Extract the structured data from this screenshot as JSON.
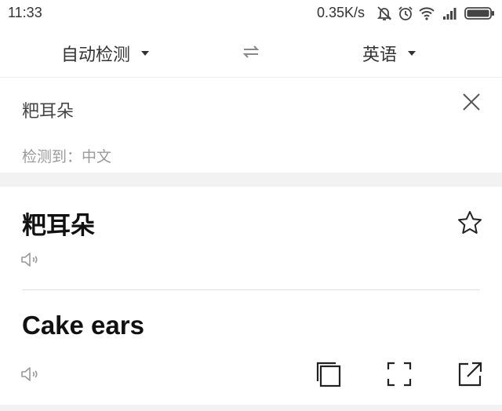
{
  "status_bar": {
    "time": "11:33",
    "network_speed": "0.35K/s",
    "icons": [
      "mute-icon",
      "alarm-icon",
      "wifi-icon",
      "signal-icon",
      "battery-icon"
    ]
  },
  "language_bar": {
    "source_language": "自动检测",
    "target_language": "英语",
    "swap_icon": "swap-icon"
  },
  "input": {
    "text": "粑耳朵",
    "detected_label": "检测到：中文",
    "clear_icon": "close-icon"
  },
  "result": {
    "source_text": "粑耳朵",
    "translation": "Cake ears",
    "icons": [
      "speaker-icon",
      "star-icon",
      "copy-icon",
      "fullscreen-icon",
      "share-icon"
    ]
  },
  "colors": {
    "background": "#ffffff",
    "divider": "#e0e0e0",
    "muted_text": "#9a9a9a",
    "section_gap": "#f2f2f2"
  }
}
